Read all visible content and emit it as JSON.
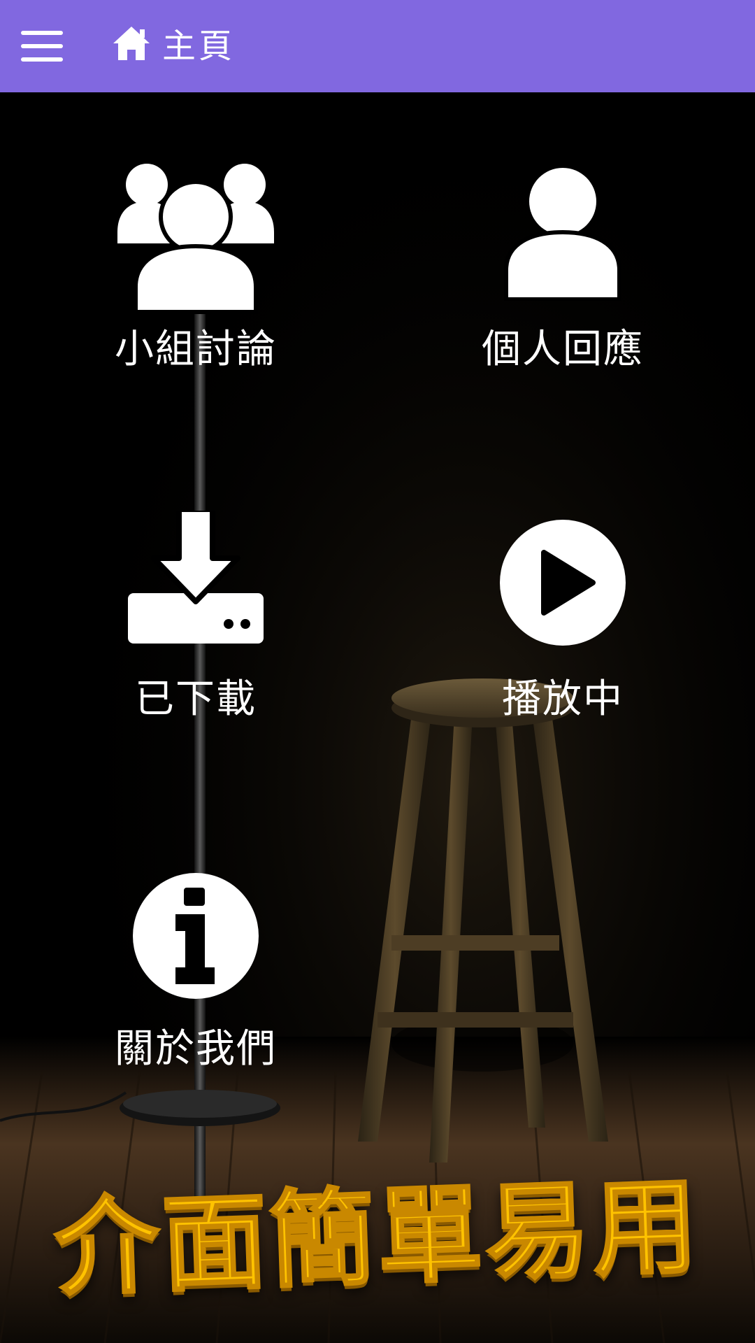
{
  "appbar": {
    "menu_icon": "hamburger-menu-icon",
    "home_icon": "home-icon",
    "title": "主頁",
    "background_color": "#8168e0"
  },
  "menu": {
    "group_discussion": {
      "label": "小組討論",
      "icon": "group-users-icon"
    },
    "personal_response": {
      "label": "個人回應",
      "icon": "user-icon"
    },
    "downloaded": {
      "label": "已下載",
      "icon": "download-icon"
    },
    "now_playing": {
      "label": "播放中",
      "icon": "play-circle-icon"
    },
    "about_us": {
      "label": "關於我們",
      "icon": "info-circle-icon"
    }
  },
  "promo": {
    "text": "介面簡單易用",
    "color": "#ffc300"
  }
}
